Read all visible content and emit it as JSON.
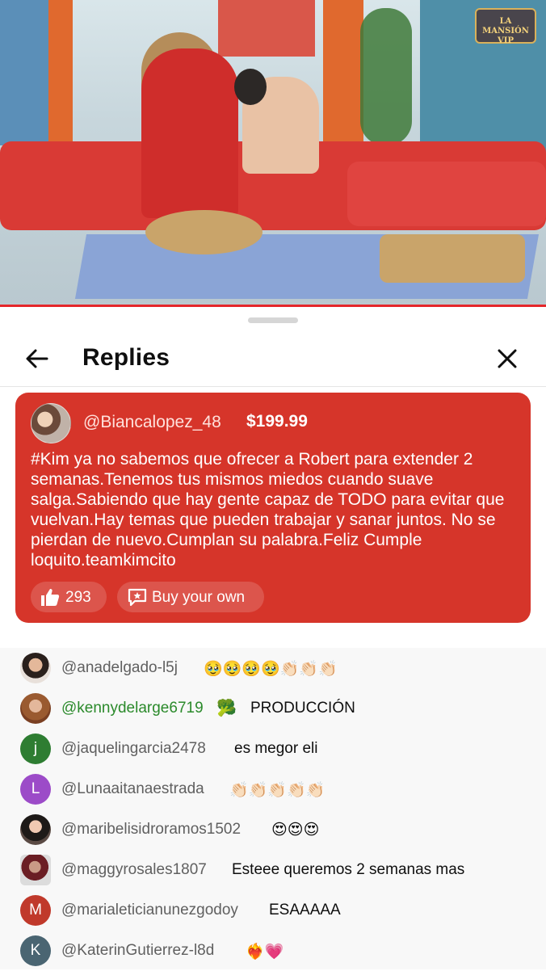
{
  "video": {
    "logo_line1": "LA MANSIÓN",
    "logo_line2": "VIP"
  },
  "sheet": {
    "title": "Replies"
  },
  "superchat": {
    "username": "@Biancalopez_48",
    "amount": "$199.99",
    "message": "#Kim ya no sabemos que ofrecer a Robert para extender 2 semanas.Tenemos tus mismos miedos cuando suave salga.Sabiendo que hay gente capaz de TODO para evitar que vuelvan.Hay temas que pueden trabajar y sanar juntos. No se pierdan de nuevo.Cumplan su palabra.Feliz Cumple loquito.teamkimcito",
    "like_count": "293",
    "buy_label": "Buy your own",
    "bg_color": "#d6352a"
  },
  "chat": {
    "messages": [
      {
        "avatar_letter": "",
        "avatar_color": "",
        "author": "@anadelgado-l5j",
        "text": "🥹🥹🥹🥹👏🏻👏🏻👏🏻",
        "badge": ""
      },
      {
        "avatar_letter": "",
        "avatar_color": "",
        "author": "@kennydelarge6719",
        "text": "PRODUCCIÓN",
        "badge": "🥦"
      },
      {
        "avatar_letter": "j",
        "avatar_color": "#2e7d32",
        "author": "@jaquelingarcia2478",
        "text": "es megor eli",
        "badge": ""
      },
      {
        "avatar_letter": "L",
        "avatar_color": "#9c4bc8",
        "author": "@Lunaaitanaestrada",
        "text": "👏🏻👏🏻👏🏻👏🏻👏🏻",
        "badge": ""
      },
      {
        "avatar_letter": "",
        "avatar_color": "",
        "author": "@maribelisidroramos1502",
        "text": "😍😍😍",
        "badge": ""
      },
      {
        "avatar_letter": "",
        "avatar_color": "",
        "author": "@maggyrosales1807",
        "text": "Esteee queremos 2 semanas mas",
        "badge": ""
      },
      {
        "avatar_letter": "M",
        "avatar_color": "#c0392b",
        "author": "@marialeticianunezgodoy",
        "text": "ESAAAAA",
        "badge": ""
      },
      {
        "avatar_letter": "K",
        "avatar_color": "#4a6572",
        "author": "@KaterinGutierrez-l8d",
        "text": "❤️‍🔥💗",
        "badge": ""
      }
    ]
  }
}
